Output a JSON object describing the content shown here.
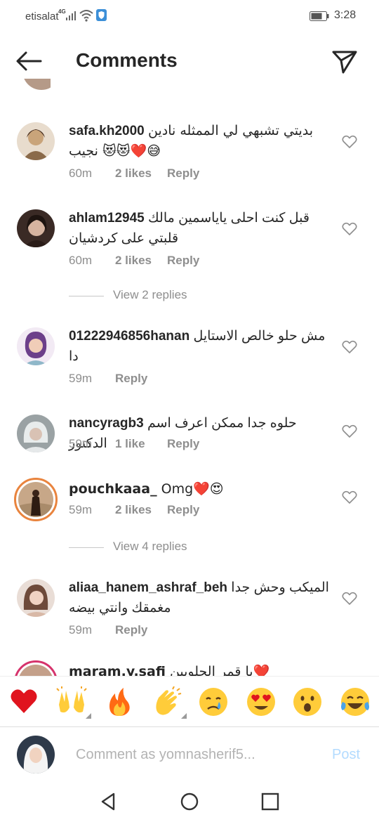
{
  "status_bar": {
    "carrier": "etisalat",
    "network": "4G",
    "time": "3:28"
  },
  "header": {
    "title": "Comments"
  },
  "comments": [
    {
      "username": "safa.kh2000",
      "text": "بديتي تشبهي لي الممثله نادين نجيب 😻😻❤️😅",
      "time": "60m",
      "likes": "2 likes",
      "reply": "Reply",
      "avatar_color": "#c9a47a"
    },
    {
      "username": "ahlam12945",
      "text": "قبل كنت احلى ياياسمين مالك قلبتي على كردشيان",
      "time": "60m",
      "likes": "2 likes",
      "reply": "Reply",
      "avatar_color": "#5a4036"
    },
    {
      "username": "01222946856hanan",
      "text": "مش حلو خالص الاستايل دا",
      "time": "59m",
      "likes": "",
      "reply": "Reply",
      "avatar_color": "#a78bb8"
    },
    {
      "username": "nancyragb3",
      "text": "حلوه جدا ممكن اعرف اسم الدكتور",
      "time": "59m",
      "likes": "1 like",
      "reply": "Reply",
      "avatar_color": "#b9bfc0"
    },
    {
      "username": "pouchkaaa_",
      "text": "Omg❤️😍",
      "time": "59m",
      "likes": "2 likes",
      "reply": "Reply",
      "avatar_color": "#7a5a40"
    },
    {
      "username": "aliaa_hanem_ashraf_beh",
      "text": "الميكب وحش جدا مغمقك وانتي بيضه",
      "time": "59m",
      "likes": "",
      "reply": "Reply",
      "avatar_color": "#6e4a3a"
    },
    {
      "username": "maram.y.safi",
      "text": "يا قمر الحلويين❤️",
      "time": "",
      "likes": "",
      "reply": "",
      "avatar_color": "#c4a08a"
    }
  ],
  "view_replies": [
    {
      "label": "View 2 replies"
    },
    {
      "label": "View 4 replies"
    }
  ],
  "reactions": [
    {
      "emoji": "❤️",
      "name": "heart"
    },
    {
      "emoji": "🙌",
      "name": "raising-hands"
    },
    {
      "emoji": "🔥",
      "name": "fire"
    },
    {
      "emoji": "👏",
      "name": "clapping-hands"
    },
    {
      "emoji": "😢",
      "name": "crying-face"
    },
    {
      "emoji": "😍",
      "name": "heart-eyes"
    },
    {
      "emoji": "😮",
      "name": "surprised-face"
    },
    {
      "emoji": "😂",
      "name": "tears-of-joy"
    }
  ],
  "comment_input": {
    "placeholder": "Comment as yomnasherif5...",
    "post_label": "Post"
  },
  "colors": {
    "accent": "#0095f6",
    "post_disabled": "#b3dbff",
    "muted": "#8e8e8e",
    "story_ring": "#e9843e"
  }
}
